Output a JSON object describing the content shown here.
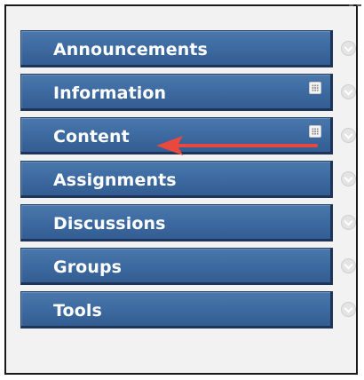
{
  "menu": {
    "items": [
      {
        "label": "Announcements",
        "has_grid_icon": false
      },
      {
        "label": "Information",
        "has_grid_icon": true
      },
      {
        "label": "Content",
        "has_grid_icon": true
      },
      {
        "label": "Assignments",
        "has_grid_icon": false
      },
      {
        "label": "Discussions",
        "has_grid_icon": false
      },
      {
        "label": "Groups",
        "has_grid_icon": false
      },
      {
        "label": "Tools",
        "has_grid_icon": false
      }
    ]
  },
  "icons": {
    "item_options": "chevron-down-circle-icon",
    "hidden_from_students": "grid-icon",
    "annotation": "red-arrow-icon"
  },
  "colors": {
    "button_fill": "#3d6aa0",
    "button_border": "#1f3f68",
    "label_text": "#ffffff",
    "annotation_arrow": "#e8483d",
    "frame_bg": "#f2f2f2"
  }
}
